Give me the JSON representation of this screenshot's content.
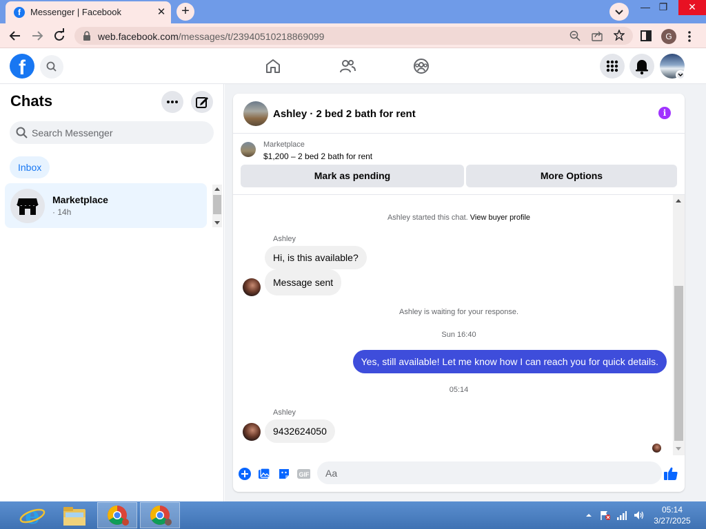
{
  "browser": {
    "tab_title": "Messenger | Facebook",
    "tab_close": "✕",
    "new_tab": "+",
    "url_domain": "web.facebook.com",
    "url_path": "/messages/t/23940510218869099",
    "profile_initial": "G",
    "window_controls": {
      "minimize": "—",
      "restore": "❐",
      "close": "✕"
    }
  },
  "fb": {
    "logo_letter": "f",
    "nav_icons": [
      "home-icon",
      "friends-icon",
      "groups-icon"
    ]
  },
  "sidebar": {
    "title": "Chats",
    "search_placeholder": "Search Messenger",
    "inbox_label": "Inbox",
    "conversations": [
      {
        "name": "Marketplace",
        "time": "· 14h",
        "selected": true
      }
    ]
  },
  "chat": {
    "title": "Ashley · 2 bed 2 bath for rent",
    "marketplace_label": "Marketplace",
    "listing": "$1,200 – 2 bed 2 bath for rent",
    "pending_button": "Mark as pending",
    "options_button": "More Options",
    "messages": {
      "started_text": "Ashley started this chat.",
      "view_profile": "View buyer profile",
      "sender_1": "Ashley",
      "msg_1": "Hi, is this available?",
      "msg_2": "Message sent",
      "waiting": "Ashley is waiting for your response.",
      "time_1": "Sun 16:40",
      "msg_out": "Yes, still available! Let me know how I can reach you for quick details.",
      "time_2": "05:14",
      "sender_2": "Ashley",
      "msg_3": "9432624050"
    },
    "composer_placeholder": "Aa",
    "accent_color": "#3e4ddb"
  },
  "taskbar": {
    "clock_time": "05:14",
    "clock_date": "3/27/2025"
  }
}
